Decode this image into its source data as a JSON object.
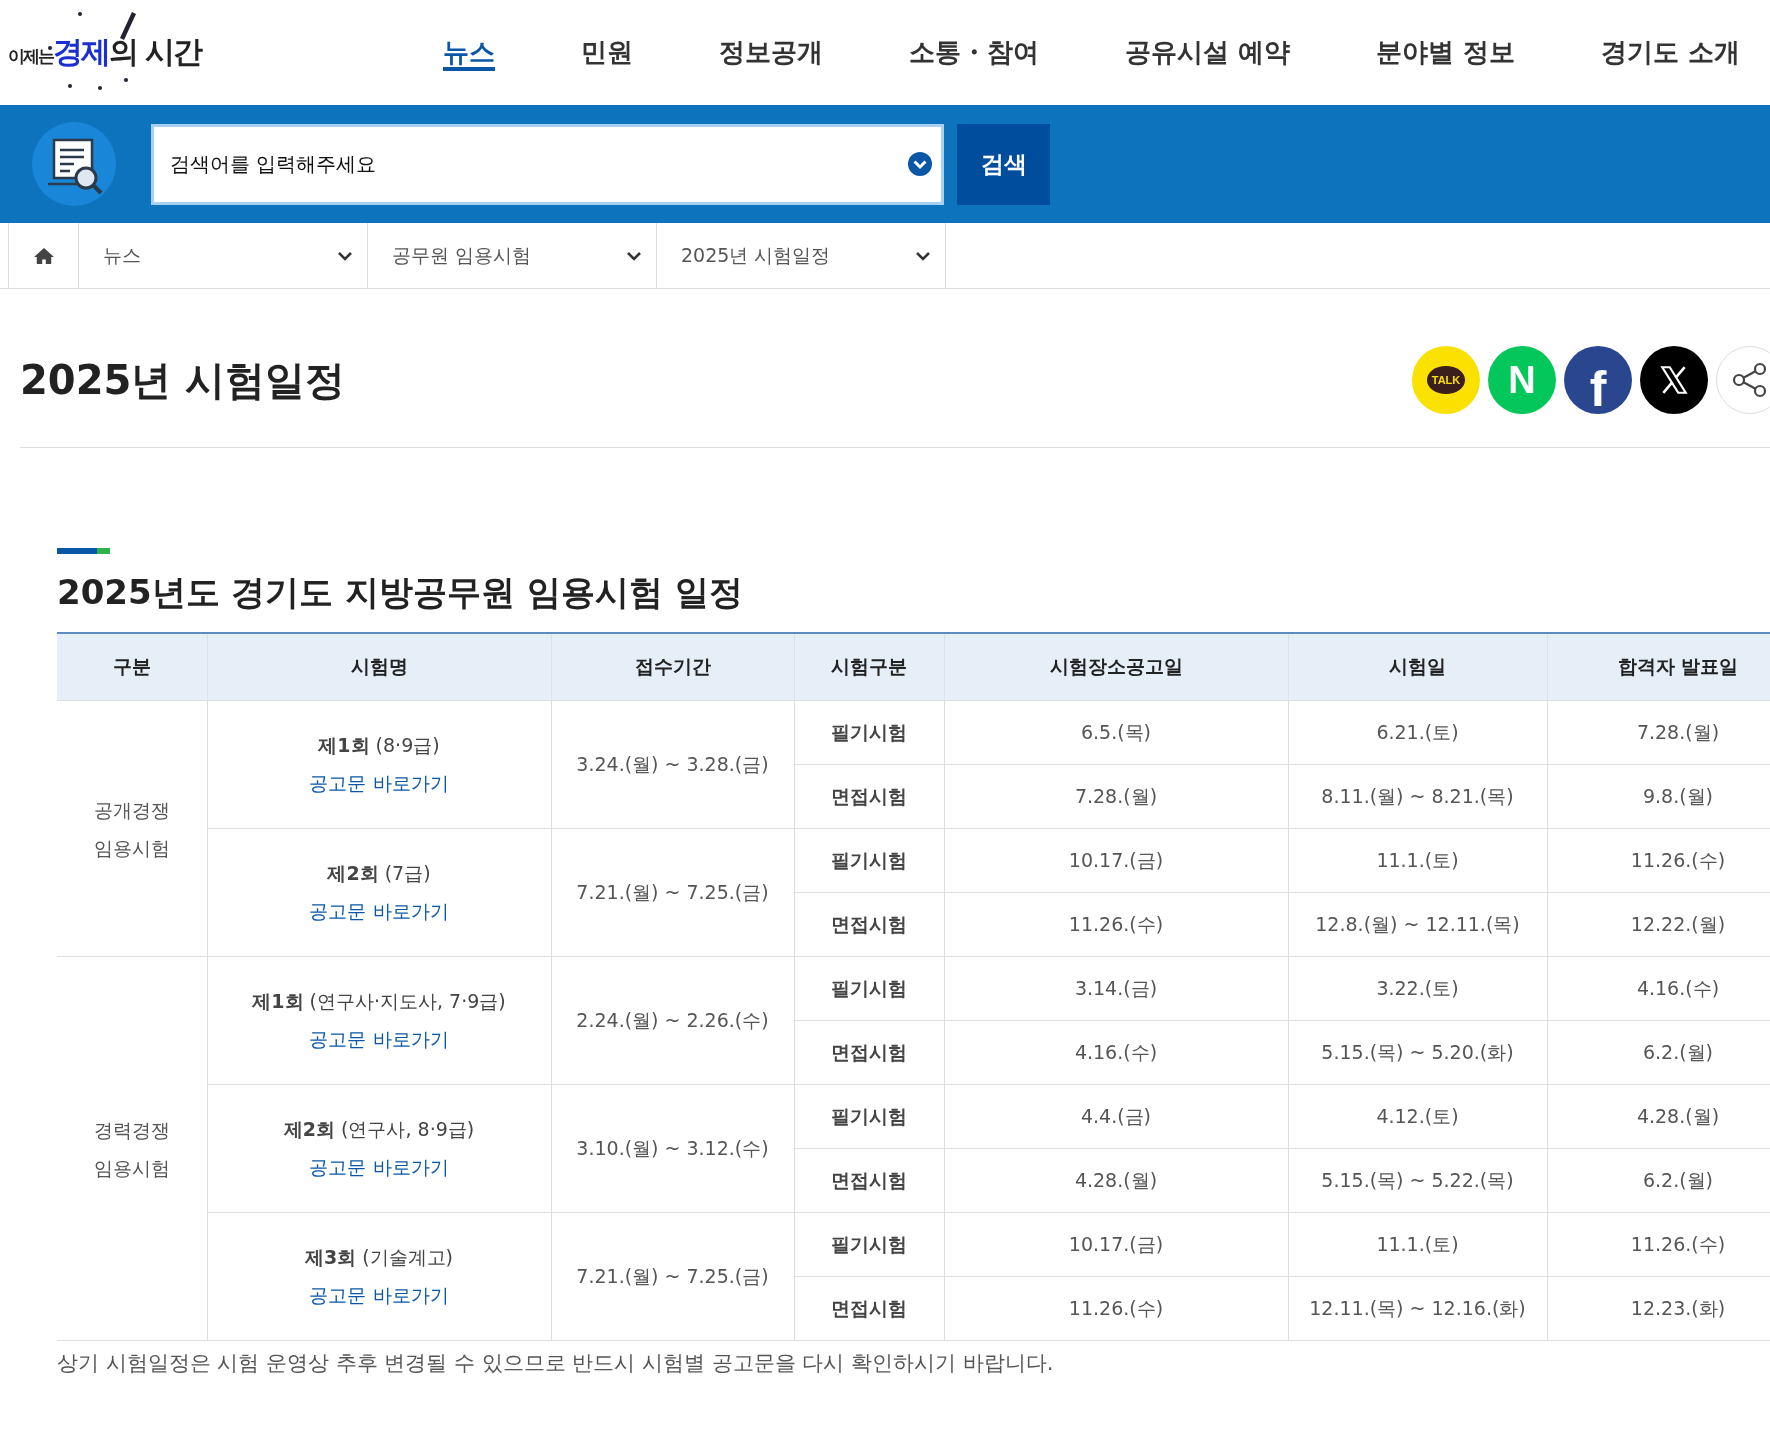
{
  "logo": {
    "prefix": "이제는",
    "highlight": "경제",
    "suffix": "의 시간"
  },
  "nav": [
    {
      "label": "뉴스",
      "selected": true
    },
    {
      "label": "민원",
      "selected": false
    },
    {
      "label": "정보공개",
      "selected": false
    },
    {
      "label": "소통・참여",
      "selected": false
    },
    {
      "label": "공유시설 예약",
      "selected": false
    },
    {
      "label": "분야별 정보",
      "selected": false
    },
    {
      "label": "경기도 소개",
      "selected": false
    }
  ],
  "search": {
    "placeholder": "검색어를 입력해주세요",
    "button": "검색"
  },
  "breadcrumb": [
    "뉴스",
    "공무원 임용시험",
    "2025년 시험일정"
  ],
  "page_title": "2025년 시험일정",
  "share_buttons": [
    {
      "kind": "kakao",
      "label": "TALK"
    },
    {
      "kind": "naver",
      "label": "N"
    },
    {
      "kind": "facebook",
      "label": "f"
    },
    {
      "kind": "x"
    },
    {
      "kind": "share"
    }
  ],
  "section_title": "2025년도 경기도 지방공무원 임용시험 일정",
  "table": {
    "columns": [
      "구분",
      "시험명",
      "접수기간",
      "시험구분",
      "시험장소공고일",
      "시험일",
      "합격자 발표일"
    ],
    "groups": [
      {
        "label": "공개경쟁\n임용시험",
        "exams": [
          {
            "name": "**제1회** (8·9급)",
            "link": "공고문 바로가기",
            "period": "3.24.(월) ~ 3.28.(금)",
            "stages": [
              {
                "type": "필기시험",
                "notice": "6.5.(목)",
                "date": "6.21.(토)",
                "result": "7.28.(월)"
              },
              {
                "type": "면접시험",
                "notice": "7.28.(월)",
                "date": "8.11.(월) ~ 8.21.(목)",
                "result": "9.8.(월)"
              }
            ]
          },
          {
            "name": "**제2회** (7급)",
            "link": "공고문 바로가기",
            "period": "7.21.(월) ~ 7.25.(금)",
            "stages": [
              {
                "type": "필기시험",
                "notice": "10.17.(금)",
                "date": "11.1.(토)",
                "result": "11.26.(수)"
              },
              {
                "type": "면접시험",
                "notice": "11.26.(수)",
                "date": "12.8.(월) ~ 12.11.(목)",
                "result": "12.22.(월)"
              }
            ]
          }
        ]
      },
      {
        "label": "경력경쟁\n임용시험",
        "exams": [
          {
            "name": "**제1회** (연구사·지도사, 7·9급)",
            "link": "공고문 바로가기",
            "period": "2.24.(월) ~ 2.26.(수)",
            "stages": [
              {
                "type": "필기시험",
                "notice": "3.14.(금)",
                "date": "3.22.(토)",
                "result": "4.16.(수)"
              },
              {
                "type": "면접시험",
                "notice": "4.16.(수)",
                "date": "5.15.(목) ~ 5.20.(화)",
                "result": "6.2.(월)"
              }
            ]
          },
          {
            "name": "**제2회** (연구사, 8·9급)",
            "link": "공고문 바로가기",
            "period": "3.10.(월) ~ 3.12.(수)",
            "stages": [
              {
                "type": "필기시험",
                "notice": "4.4.(금)",
                "date": "4.12.(토)",
                "result": "4.28.(월)"
              },
              {
                "type": "면접시험",
                "notice": "4.28.(월)",
                "date": "5.15.(목) ~ 5.22.(목)",
                "result": "6.2.(월)"
              }
            ]
          },
          {
            "name": "**제3회** (기술계고)",
            "link": "공고문 바로가기",
            "period": "7.21.(월) ~ 7.25.(금)",
            "stages": [
              {
                "type": "필기시험",
                "notice": "10.17.(금)",
                "date": "11.1.(토)",
                "result": "11.26.(수)"
              },
              {
                "type": "면접시험",
                "notice": "11.26.(수)",
                "date": "12.11.(목) ~ 12.16.(화)",
                "result": "12.23.(화)"
              }
            ]
          }
        ]
      }
    ]
  },
  "note": "상기 시험일정은 시험 운영상 추후 변경될 수 있으므로 반드시 시험별 공고문을 다시 확인하시기 바랍니다."
}
